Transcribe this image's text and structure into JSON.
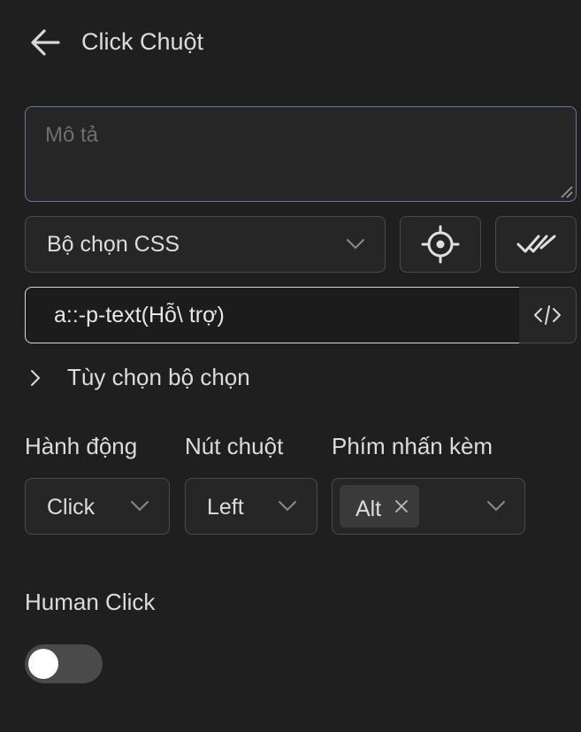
{
  "header": {
    "title": "Click Chuột",
    "back_icon": "arrow-left-icon"
  },
  "description": {
    "placeholder": "Mô tả",
    "value": ""
  },
  "selector": {
    "type_value": "Bộ chọn CSS",
    "pick_icon": "crosshair-icon",
    "check_icon": "double-check-icon",
    "value": "a::-p-text(Hỗ\\ trợ)",
    "code_icon": "code-icon"
  },
  "selector_options": {
    "label": "Tùy chọn bộ chọn"
  },
  "action": {
    "label": "Hành động",
    "value": "Click"
  },
  "mouse_button": {
    "label": "Nút chuột",
    "value": "Left"
  },
  "modifiers": {
    "label": "Phím nhấn kèm",
    "tags": [
      "Alt"
    ]
  },
  "human_click": {
    "label": "Human Click",
    "enabled": false
  },
  "colors": {
    "background": "#1f1f1f",
    "focus_border": "#5b7aa6",
    "border": "#4a4a4a",
    "text": "#dcdcdc"
  }
}
